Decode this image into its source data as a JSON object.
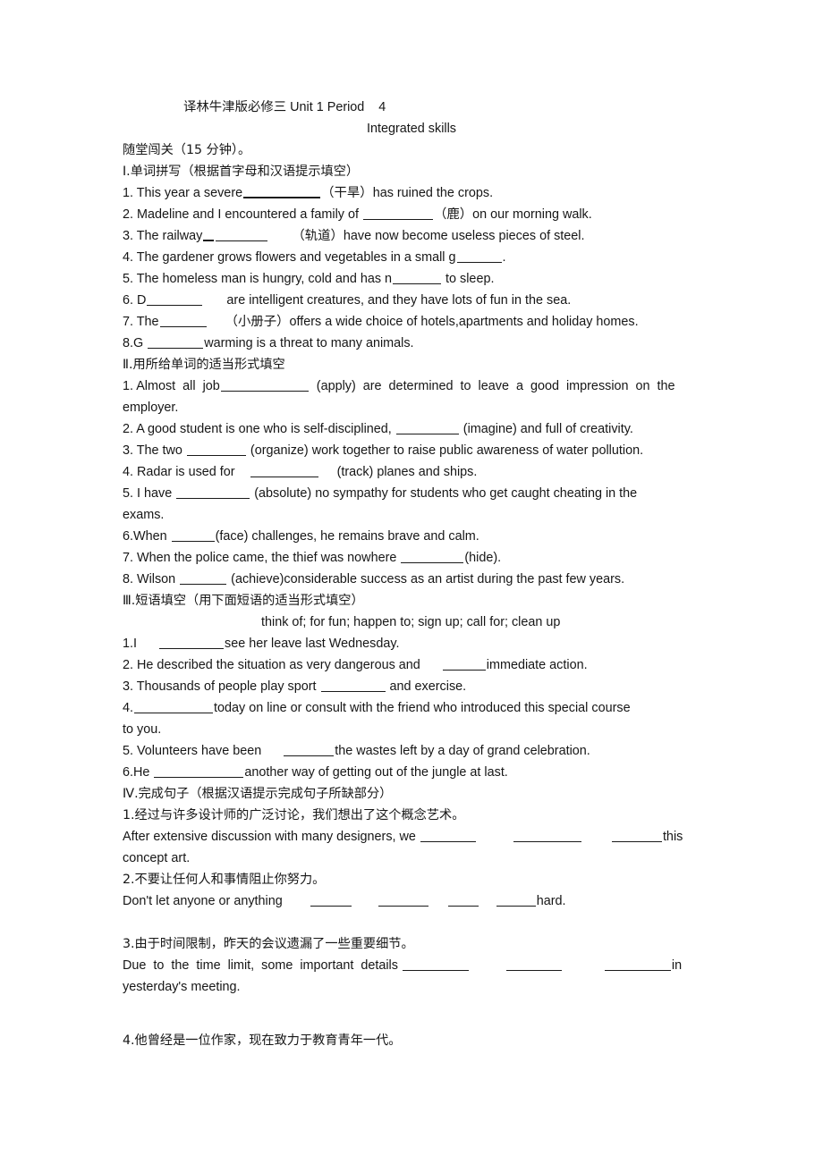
{
  "document": {
    "title_line1": "译林牛津版必修三 Unit 1 Period    4",
    "title_line2": "Integrated skills",
    "intro": "随堂闯关（15 分钟）。"
  },
  "sections": [
    {
      "heading": "I.单词拼写（根据首字母和汉语提示填空）",
      "items": [
        {
          "pre": "1. This year a severe",
          "mid": "（干旱）has ruined the crops.",
          "post": ""
        },
        {
          "pre": "2. Madeline and I encountered a family of ",
          "mid": "（鹿）on our morning walk.",
          "post": ""
        },
        {
          "pre": "3. The railway",
          "mid": "（轨道）have now become useless pieces of steel.",
          "post": ""
        },
        {
          "pre": "4. The gardener grows flowers and vegetables in a small g",
          "mid": ".",
          "post": ""
        },
        {
          "pre": "5. The homeless man is hungry, cold and has n",
          "mid": " to sleep.",
          "post": ""
        },
        {
          "pre": "6. D",
          "mid": " are intelligent creatures, and they have lots of fun in the sea.",
          "post": ""
        },
        {
          "pre": "7. The",
          "mid": "（小册子）offers a wide choice of hotels,apartments and holiday homes.",
          "post": ""
        },
        {
          "pre": "8.G ",
          "mid": "warming is a threat to many animals.",
          "post": ""
        }
      ]
    },
    {
      "heading": "Ⅱ.用所给单词的适当形式填空",
      "items": [
        {
          "pre": "1. Almost  all  job",
          "mid": "  (apply)  are  determined  to  leave  a  good  impression  on  the",
          "post": "employer."
        },
        {
          "pre": "2. A good student is one who is self-disciplined, ",
          "mid": " (imagine) and full of creativity.",
          "post": ""
        },
        {
          "pre": "3. The two ",
          "mid": " (organize) work together to raise public awareness of water pollution.",
          "post": ""
        },
        {
          "pre": "4. Radar is used for    ",
          "mid": " (track) planes and ships.",
          "post": ""
        },
        {
          "pre": "5. I have ",
          "mid": " (absolute) no sympathy for students who get caught cheating in the",
          "post": "exams."
        },
        {
          "pre": "6.When ",
          "mid": "(face) challenges, he remains brave and calm.",
          "post": ""
        },
        {
          "pre": "7. When the police came, the thief was nowhere ",
          "mid": "(hide).",
          "post": ""
        },
        {
          "pre": "8. Wilson ",
          "mid": " (achieve)considerable success as an artist during the past few years.",
          "post": ""
        }
      ]
    },
    {
      "heading": "Ⅲ.短语填空（用下面短语的适当形式填空）",
      "phrase_bank": "think of; for fun; happen to; sign up; call for; clean up",
      "items": [
        {
          "pre": "1.I ",
          "mid": "see her leave last Wednesday.",
          "post": ""
        },
        {
          "pre": "2. He described the situation as very dangerous and  ",
          "mid": "immediate action.",
          "post": ""
        },
        {
          "pre": "3. Thousands of people play sport ",
          "mid": " and exercise.",
          "post": ""
        },
        {
          "pre": "4.",
          "mid": "today on line or consult with the friend who introduced this special course",
          "post": "to you."
        },
        {
          "pre": "5. Volunteers have been  ",
          "mid": "the wastes left by a day of grand celebration.",
          "post": ""
        },
        {
          "pre": "6.He ",
          "mid": "another way of getting out of the jungle at last.",
          "post": ""
        }
      ]
    },
    {
      "heading": "Ⅳ.完成句子（根据汉语提示完成句子所缺部分）",
      "items": [
        {
          "cn": "1.经过与许多设计师的广泛讨论，我们想出了这个概念艺术。",
          "en_pre": "After extensive discussion with many designers, we ",
          "en_tail": "this",
          "en_next": "concept art."
        },
        {
          "cn": "2.不要让任何人和事情阻止你努力。",
          "en_pre": "Don't let anyone or anything  ",
          "en_tail": "hard.",
          "en_next": ""
        },
        {
          "cn": "3.由于时间限制，昨天的会议遗漏了一些重要细节。",
          "en_pre": "Due  to  the  time  limit,  some  important  details ",
          "en_tail": "in",
          "en_next": "yesterday's meeting."
        },
        {
          "cn": "4.他曾经是一位作家，现在致力于教育青年一代。",
          "en_pre": "",
          "en_tail": "",
          "en_next": ""
        }
      ]
    }
  ]
}
